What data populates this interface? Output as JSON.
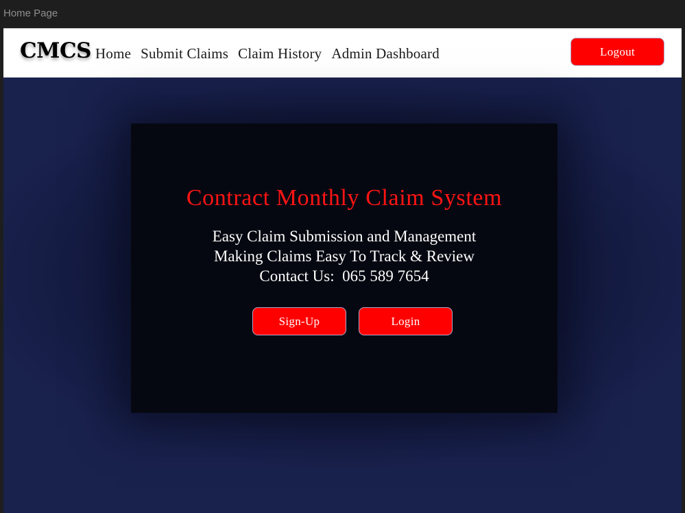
{
  "window": {
    "title": "Home Page"
  },
  "navbar": {
    "brand": "CMCS",
    "links": [
      {
        "label": "Home"
      },
      {
        "label": "Submit Claims"
      },
      {
        "label": "Claim History"
      },
      {
        "label": "Admin Dashboard"
      }
    ],
    "logout_label": "Logout"
  },
  "hero": {
    "title": "Contract Monthly Claim System",
    "lines": [
      "Easy Claim Submission and Management",
      "Making Claims Easy To Track & Review",
      "Contact Us:  065 589 7654"
    ],
    "signup_label": "Sign-Up",
    "login_label": "Login"
  },
  "colors": {
    "background": "#19214d",
    "accent": "#ff0000",
    "hero_panel": "#060811",
    "title_red": "#ff1414",
    "navbar": "#ffffff"
  }
}
